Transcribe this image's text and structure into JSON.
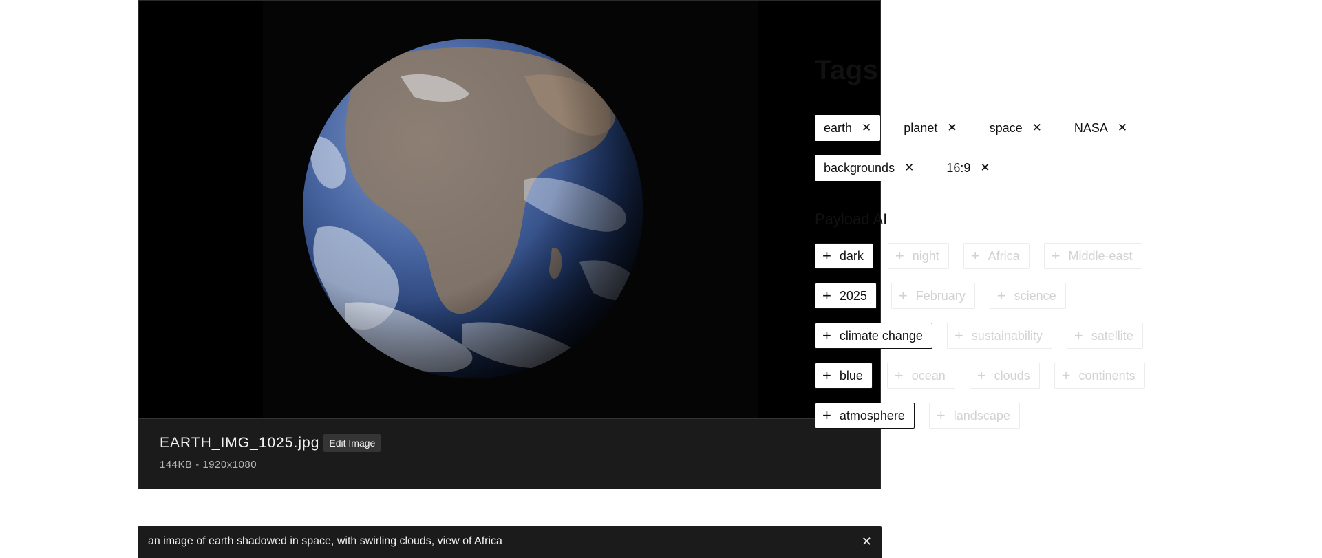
{
  "file": {
    "name": "EARTH_IMG_1025.jpg",
    "edit_label": "Edit Image",
    "meta": "144KB - 1920x1080"
  },
  "tags_panel": {
    "title": "Tags",
    "remove_icon": "close-icon",
    "tags": [
      "earth",
      "planet",
      "space",
      "NASA",
      "backgrounds",
      "16:9"
    ]
  },
  "ai_panel": {
    "title": "Payload AI",
    "add_icon": "plus-icon",
    "suggestions": [
      [
        "dark",
        "night",
        "Africa",
        "Middle-east"
      ],
      [
        "2025",
        "February",
        "science"
      ],
      [
        "climate change",
        "sustainability",
        "satellite"
      ],
      [
        "blue",
        "ocean",
        "clouds",
        "continents"
      ],
      [
        "atmosphere",
        "landscape"
      ]
    ]
  },
  "caption": {
    "text": "an image of earth shadowed  in space, with swirling clouds, view of Africa",
    "close_icon": "close-icon"
  },
  "colors": {
    "card_bg": "#000000",
    "info_bar_bg": "#1b1b1b",
    "selected_tag_border": "#111111",
    "suggestion_text": "#d2d2d2"
  }
}
